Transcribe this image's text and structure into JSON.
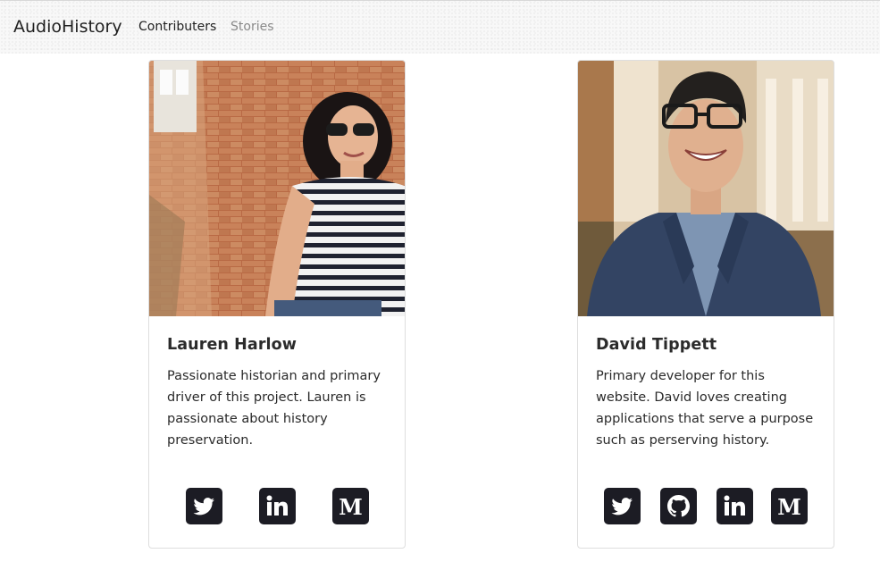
{
  "navbar": {
    "brand": "AudioHistory",
    "links": [
      {
        "label": "Contributers",
        "state": "active"
      },
      {
        "label": "Stories",
        "state": "inactive"
      }
    ]
  },
  "cards": [
    {
      "name": "Lauren Harlow",
      "description": "Passionate historian and primary driver of this project. Lauren is passionate about history preservation.",
      "socials": [
        {
          "icon": "twitter-icon"
        },
        {
          "icon": "linkedin-icon"
        },
        {
          "icon": "medium-icon"
        }
      ]
    },
    {
      "name": "David Tippett",
      "description": "Primary developer for this website. David loves creating applications that serve a purpose such as perserving history.",
      "socials": [
        {
          "icon": "twitter-icon"
        },
        {
          "icon": "github-icon"
        },
        {
          "icon": "linkedin-icon"
        },
        {
          "icon": "medium-icon"
        }
      ]
    }
  ],
  "colors": {
    "icon_background": "#1c1c24",
    "card_border": "#dedede",
    "navbar_background": "#f8f8f8",
    "muted_link": "#8a8a8a"
  }
}
